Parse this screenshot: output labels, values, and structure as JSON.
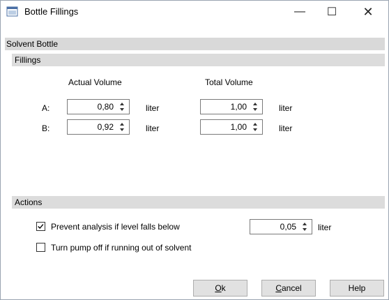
{
  "window": {
    "title": "Bottle Fillings",
    "minimize_glyph": "—",
    "maximize_glyph": "☐",
    "close_glyph": "✕"
  },
  "sections": {
    "solvent_bottle": "Solvent Bottle",
    "fillings": "Fillings",
    "actions": "Actions"
  },
  "fillings": {
    "col_actual": "Actual Volume",
    "col_total": "Total Volume",
    "rows": [
      {
        "label": "A:",
        "actual": "0,80",
        "actual_unit": "liter",
        "total": "1,00",
        "total_unit": "liter"
      },
      {
        "label": "B:",
        "actual": "0,92",
        "actual_unit": "liter",
        "total": "1,00",
        "total_unit": "liter"
      }
    ]
  },
  "actions": {
    "prevent": {
      "label": "Prevent analysis if level falls below",
      "checked": true,
      "value": "0,05",
      "unit": "liter"
    },
    "pump_off": {
      "label": "Turn pump off if running out of solvent",
      "checked": false
    }
  },
  "buttons": {
    "ok_mnemonic": "O",
    "ok_rest": "k",
    "cancel_mnemonic": "C",
    "cancel_rest": "ancel",
    "help": "Help"
  }
}
